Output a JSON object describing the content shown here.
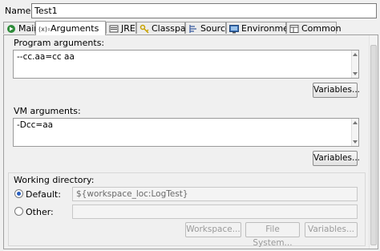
{
  "name_row": {
    "label": "Name:",
    "value": "Test1"
  },
  "tabs": [
    {
      "label": "Main",
      "icon": "main-icon"
    },
    {
      "label": "Arguments",
      "icon": "arguments-icon"
    },
    {
      "label": "JRE",
      "icon": "jre-icon"
    },
    {
      "label": "Classpath",
      "icon": "classpath-icon"
    },
    {
      "label": "Source",
      "icon": "source-icon"
    },
    {
      "label": "Environment",
      "icon": "environment-icon"
    },
    {
      "label": "Common",
      "icon": "common-icon"
    }
  ],
  "active_tab": "Arguments",
  "program_args": {
    "label": "Program arguments:",
    "value": "--cc.aa=cc aa",
    "variables_label": "Variables..."
  },
  "vm_args": {
    "label": "VM arguments:",
    "value": "-Dcc=aa",
    "variables_label": "Variables..."
  },
  "working_dir": {
    "label": "Working directory:",
    "default_label": "Default:",
    "default_value": "${workspace_loc:LogTest}",
    "other_label": "Other:",
    "other_value": "",
    "workspace_label": "Workspace...",
    "filesystem_label": "File System...",
    "variables_label": "Variables..."
  },
  "colors": {
    "active_tab_bg": "#ffffff",
    "selection_blue": "#2a5fbe"
  }
}
